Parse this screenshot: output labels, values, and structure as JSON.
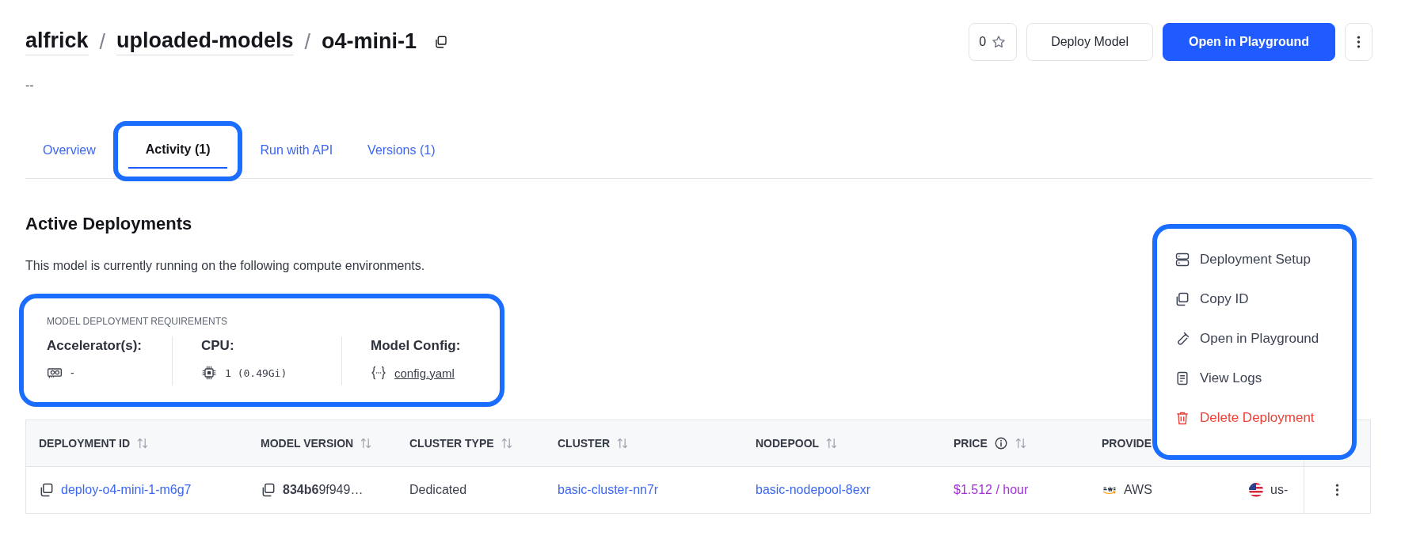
{
  "breadcrumb": [
    "alfrick",
    "uploaded-models",
    "o4-mini-1"
  ],
  "breadcrumb_separator": "/",
  "description": "--",
  "star_count": "0",
  "header_buttons": [
    {
      "label": "Deploy Model",
      "kind": "secondary"
    },
    {
      "label": "Open in Playground",
      "kind": "primary"
    }
  ],
  "tabs": [
    {
      "label": "Overview",
      "selected": false,
      "highlighted": false
    },
    {
      "label": "Activity (1)",
      "selected": true,
      "highlighted": true
    },
    {
      "label": "Run with API",
      "selected": false,
      "highlighted": false
    },
    {
      "label": "Versions (1)",
      "selected": false,
      "highlighted": false
    }
  ],
  "section_title": "Active Deployments",
  "section_text": "This model is currently running on the following compute environments.",
  "requirements": {
    "highlighted": true,
    "title": "MODEL DEPLOYMENT REQUIREMENTS",
    "items": [
      {
        "kind": "accelerator",
        "label": "Accelerator(s):",
        "value": "-"
      },
      {
        "kind": "cpu",
        "label": "CPU:",
        "value": "1 (0.49Gi)"
      },
      {
        "kind": "config",
        "label": "Model Config:",
        "value": "config.yaml"
      }
    ]
  },
  "table": {
    "columns": [
      {
        "label": "DEPLOYMENT ID",
        "sortable": true,
        "info": false
      },
      {
        "label": "MODEL VERSION",
        "sortable": true,
        "info": false
      },
      {
        "label": "CLUSTER TYPE",
        "sortable": true,
        "info": false
      },
      {
        "label": "CLUSTER",
        "sortable": true,
        "info": false
      },
      {
        "label": "NODEPOOL",
        "sortable": true,
        "info": false
      },
      {
        "label": "PRICE",
        "sortable": true,
        "info": true
      },
      {
        "label": "PROVIDE"
      }
    ],
    "rows": [
      {
        "deployment_id": "deploy-o4-mini-1-m6g7",
        "model_version": "**834b6**9f949…",
        "cluster_type": "Dedicated",
        "cluster": "basic-cluster-nn7r",
        "nodepool": "basic-nodepool-8exr",
        "price": "$1.512 / hour",
        "provider": "AWS",
        "region": "us-"
      }
    ]
  },
  "menu": {
    "highlighted": true,
    "items": [
      {
        "label": "Deployment Setup",
        "kind": "setup"
      },
      {
        "label": "Copy ID",
        "kind": "copy"
      },
      {
        "label": "Open in Playground",
        "kind": "playground"
      },
      {
        "label": "View Logs",
        "kind": "logs"
      },
      {
        "label": "Delete Deployment",
        "kind": "delete"
      }
    ]
  }
}
